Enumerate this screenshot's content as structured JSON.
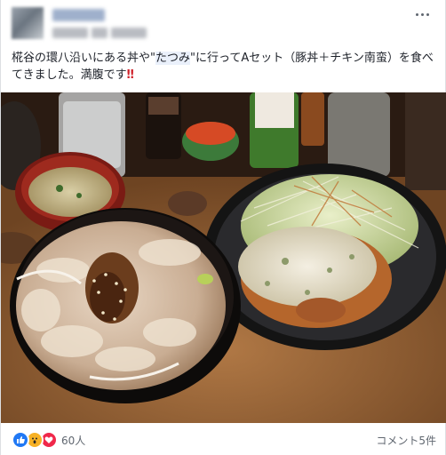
{
  "post": {
    "author_name": "██████",
    "meta_blur_1": "",
    "meta_blur_2": "",
    "text_before": "椛谷の環八沿いにある丼や\"",
    "text_highlight": "たつみ",
    "text_after": "\"に行ってAセット（豚丼＋チキン南蛮）を食べてきました。満腹です",
    "text_emoji": "‼"
  },
  "photo": {
    "alt_subject": "pork-rice-bowl-and-chicken-nanban-set"
  },
  "footer": {
    "reaction_count": "60人",
    "comment_count": "コメント5件"
  },
  "icons": {
    "like": "thumbs-up-icon",
    "wow": "wow-face-icon",
    "love": "heart-icon",
    "more": "more-dots-icon"
  },
  "colors": {
    "link": "#385898",
    "like": "#2078f4",
    "wow": "#f7b125",
    "love": "#f0284a",
    "emphasis": "#d0222b"
  }
}
